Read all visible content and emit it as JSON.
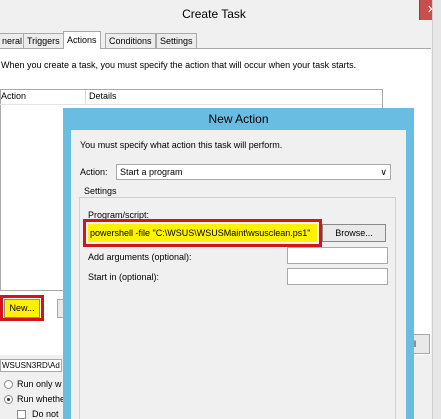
{
  "create_task": {
    "title": "Create Task",
    "close_glyph": "✕",
    "tabs": [
      {
        "label": "neral"
      },
      {
        "label": "Triggers"
      },
      {
        "label": "Actions",
        "active": true
      },
      {
        "label": "Conditions"
      },
      {
        "label": "Settings"
      }
    ],
    "intro_text": "When you create a task, you must specify the action that will occur when your task starts.",
    "columns": [
      "Action",
      "Details"
    ],
    "new_button_label": "New...",
    "ok_button_label": "el",
    "account_text": "WSUSN3RD\\Ad",
    "radio_run_only": "Run only w",
    "radio_run_whether": "Run whethe",
    "checkbox_do_not": "Do not"
  },
  "new_action": {
    "title": "New Action",
    "intro_text": "You must specify what action this task will perform.",
    "action_label": "Action:",
    "action_value": "Start a program",
    "settings_label": "Settings",
    "program_label": "Program/script:",
    "program_value": "powershell -file \"C:\\WSUS\\WSUSMaint\\wsusclean.ps1\"",
    "browse_label": "Browse...",
    "args_label": "Add arguments (optional):",
    "start_in_label": "Start in (optional):",
    "dropdown_icon": "chevron-down-icon"
  },
  "colors": {
    "highlight_yellow": "#fff200",
    "annotation_red": "#d0151c",
    "dialog_frame_blue": "#69bde3",
    "close_button_red": "#c7504c"
  }
}
